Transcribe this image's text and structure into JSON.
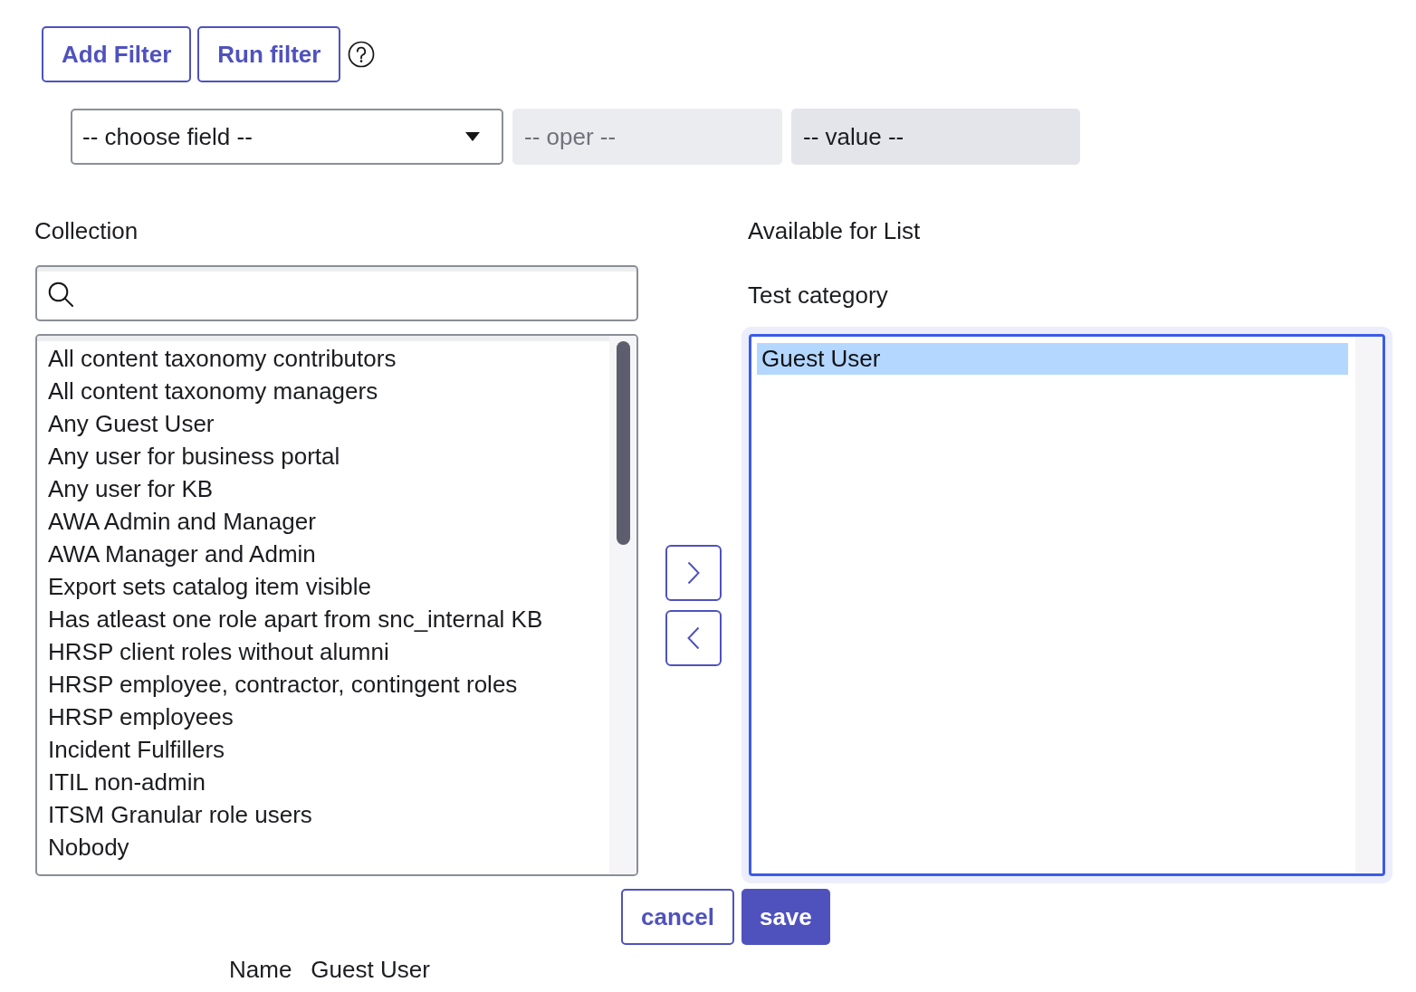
{
  "filter_buttons": [
    {
      "label": "Add Filter"
    },
    {
      "label": "Run filter"
    }
  ],
  "filter_row": [
    {
      "kind": "select",
      "text": "-- choose field --",
      "disabled": false
    },
    {
      "kind": "select",
      "text": "-- oper --",
      "disabled": true
    },
    {
      "kind": "input",
      "text": "-- value --",
      "disabled": true
    }
  ],
  "collection": {
    "label": "Collection",
    "items": [
      {
        "label": "All content taxonomy contributors",
        "selected": false
      },
      {
        "label": "All content taxonomy managers",
        "selected": false
      },
      {
        "label": "Any Guest User",
        "selected": false
      },
      {
        "label": "Any user for business portal",
        "selected": false
      },
      {
        "label": "Any user for KB",
        "selected": false
      },
      {
        "label": "AWA Admin and Manager",
        "selected": false
      },
      {
        "label": "AWA Manager and Admin",
        "selected": false
      },
      {
        "label": "Export sets catalog item visible",
        "selected": false
      },
      {
        "label": "Has atleast one role apart from snc_internal KB",
        "selected": false
      },
      {
        "label": "HRSP client roles without alumni",
        "selected": false
      },
      {
        "label": "HRSP employee, contractor, contingent roles",
        "selected": false
      },
      {
        "label": "HRSP employees",
        "selected": false
      },
      {
        "label": "Incident Fulfillers",
        "selected": false
      },
      {
        "label": "ITIL non-admin",
        "selected": false
      },
      {
        "label": "ITSM Granular role users",
        "selected": false
      },
      {
        "label": "Nobody",
        "selected": false
      }
    ]
  },
  "available": {
    "label": "Available for List",
    "category": "Test category",
    "focused": true,
    "items": [
      {
        "label": "Guest User",
        "selected": true
      }
    ]
  },
  "actions": [
    {
      "label": "cancel",
      "kind": "secondary"
    },
    {
      "label": "save",
      "kind": "primary"
    }
  ],
  "details": [
    {
      "label": "Name",
      "value": "Guest User"
    }
  ]
}
